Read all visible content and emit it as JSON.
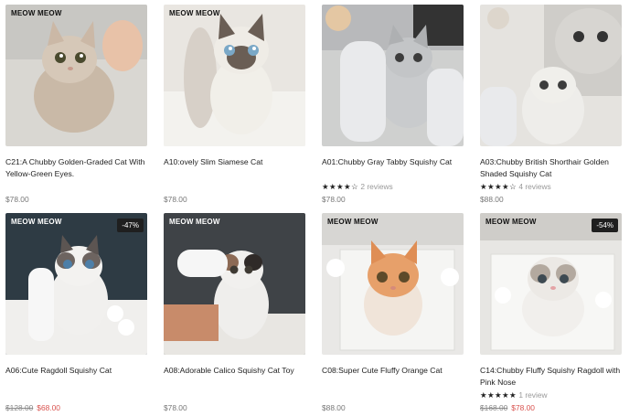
{
  "products": [
    {
      "title": "C21:A Chubby Golden-Graded Cat With Yellow-Green Eyes.",
      "brand": "MEOW MEOW",
      "price": "$78.00"
    },
    {
      "title": "A10:ovely Slim Siamese Cat",
      "brand": "MEOW MEOW",
      "price": "$78.00"
    },
    {
      "title": "A01:Chubby Gray Tabby Squishy Cat",
      "stars": "★★★★☆",
      "reviews": "2 reviews",
      "price": "$78.00"
    },
    {
      "title": "A03:Chubby British Shorthair Golden Shaded Squishy Cat",
      "stars": "★★★★☆",
      "reviews": "4 reviews",
      "price": "$88.00"
    },
    {
      "title": "A06:Cute Ragdoll Squishy Cat",
      "brand": "MEOW MEOW",
      "badge": "-47%",
      "old_price": "$128.00",
      "sale_price": "$68.00"
    },
    {
      "title": "A08:Adorable Calico Squishy Cat Toy",
      "brand": "MEOW MEOW",
      "price": "$78.00"
    },
    {
      "title": "C08:Super Cute Fluffy Orange Cat",
      "brand": "MEOW MEOW",
      "price": "$88.00"
    },
    {
      "title": "C14:Chubby Fluffy Squishy Ragdoll with Pink Nose",
      "brand": "MEOW MEOW",
      "badge": "-54%",
      "stars": "★★★★★",
      "reviews": "1 review",
      "old_price": "$168.00",
      "sale_price": "$78.00"
    }
  ],
  "colors": {
    "sale": "#d9534f",
    "text": "#222222",
    "muted": "#777777"
  }
}
